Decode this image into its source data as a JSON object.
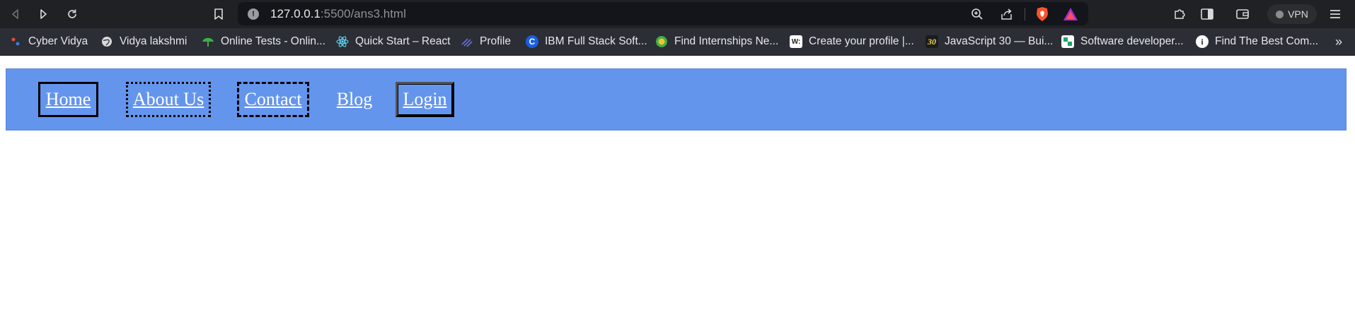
{
  "browser": {
    "url_host": "127.0.0.1",
    "url_path": ":5500/ans3.html",
    "vpn_label": "VPN",
    "icons": [
      "back-icon",
      "forward-icon",
      "reload-icon",
      "bookmark-icon",
      "info-icon",
      "zoom-icon",
      "share-icon",
      "brave-shield-icon",
      "brave-rewards-icon",
      "extensions-icon",
      "sidebar-icon",
      "wallet-icon",
      "menu-icon"
    ]
  },
  "bookmarks": {
    "items": [
      {
        "label": "Cyber Vidya",
        "color": "#e04f3a"
      },
      {
        "label": "Vidya lakshmi",
        "color": "#d9d9d9"
      },
      {
        "label": "Online Tests - Onlin...",
        "color": "#3fae49"
      },
      {
        "label": "Quick Start – React",
        "color": "#61dafb"
      },
      {
        "label": "Profile",
        "color": "#6b6be0"
      },
      {
        "label": "IBM Full Stack Soft...",
        "color": "#1b5ee0"
      },
      {
        "label": "Find Internships Ne...",
        "color": "#f2c230"
      },
      {
        "label": "Create your profile |...",
        "color": "#ffffff"
      },
      {
        "label": "JavaScript 30 — Bui...",
        "color": "#f0db4f"
      },
      {
        "label": "Software developer...",
        "color": "#1fa463"
      },
      {
        "label": "Find The Best Com...",
        "color": "#ffffff"
      }
    ],
    "more": "»"
  },
  "nav": {
    "home": "Home",
    "about": "About Us",
    "contact": "Contact",
    "blog": "Blog",
    "login": "Login"
  }
}
